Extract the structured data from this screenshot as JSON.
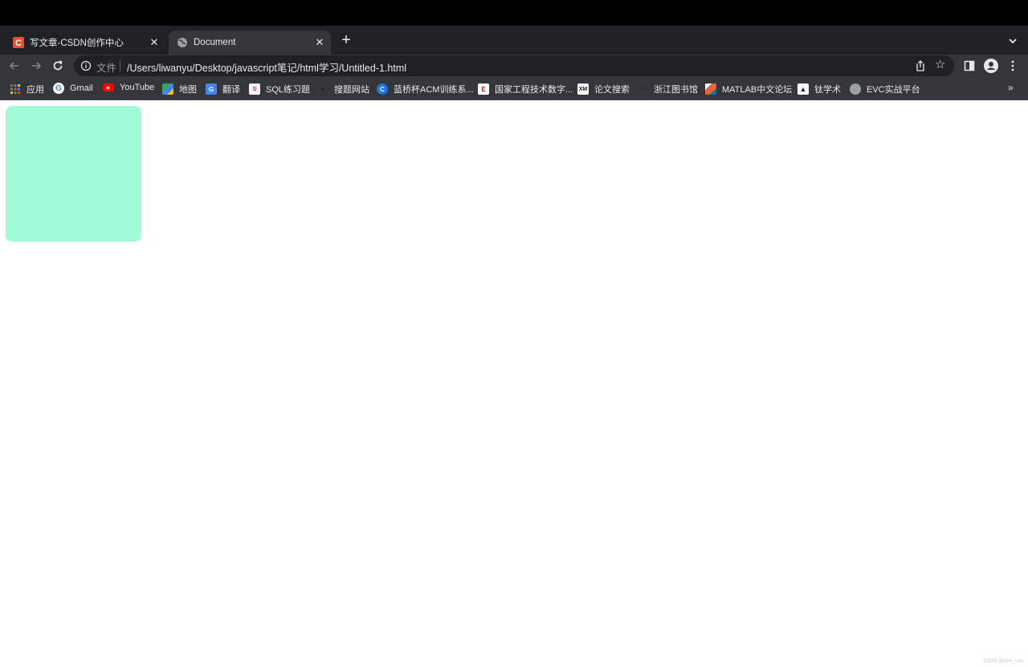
{
  "tabs": [
    {
      "title": "写文章-CSDN创作中心",
      "favicon": "csdn-c-icon",
      "active": false
    },
    {
      "title": "Document",
      "favicon": "globe-icon",
      "active": true
    }
  ],
  "toolbar": {
    "security_chip": "文件",
    "url": "/Users/liwanyu/Desktop/javascript笔记/html学习/Untitled-1.html"
  },
  "bookmarks": [
    {
      "label": "应用",
      "icon": "apps-grid-icon"
    },
    {
      "label": "Gmail",
      "icon": "google-icon"
    },
    {
      "label": "YouTube",
      "icon": "youtube-icon"
    },
    {
      "label": "地图",
      "icon": "maps-icon"
    },
    {
      "label": "翻译",
      "icon": "translate-icon"
    },
    {
      "label": "SQL练习题",
      "icon": "sql-icon"
    },
    {
      "label": "搜题网站",
      "icon": "search-site-icon"
    },
    {
      "label": "蓝桥杯ACM训练系...",
      "icon": "lanqiao-icon"
    },
    {
      "label": "国家工程技术数字...",
      "icon": "engineering-icon"
    },
    {
      "label": "论文搜索",
      "icon": "xm-icon"
    },
    {
      "label": "浙江图书馆",
      "icon": "library-icon"
    },
    {
      "label": "MATLAB中文论坛",
      "icon": "matlab-icon"
    },
    {
      "label": "钛学术",
      "icon": "academic-icon"
    },
    {
      "label": "EVC实战平台",
      "icon": "globe-icon"
    }
  ],
  "page": {
    "box_color": "#9ffcd7"
  },
  "watermark": "CSDN @lone_one",
  "colors": {
    "titlebar": "#202124",
    "toolbar": "#35363a",
    "text": "#e8eaed"
  }
}
